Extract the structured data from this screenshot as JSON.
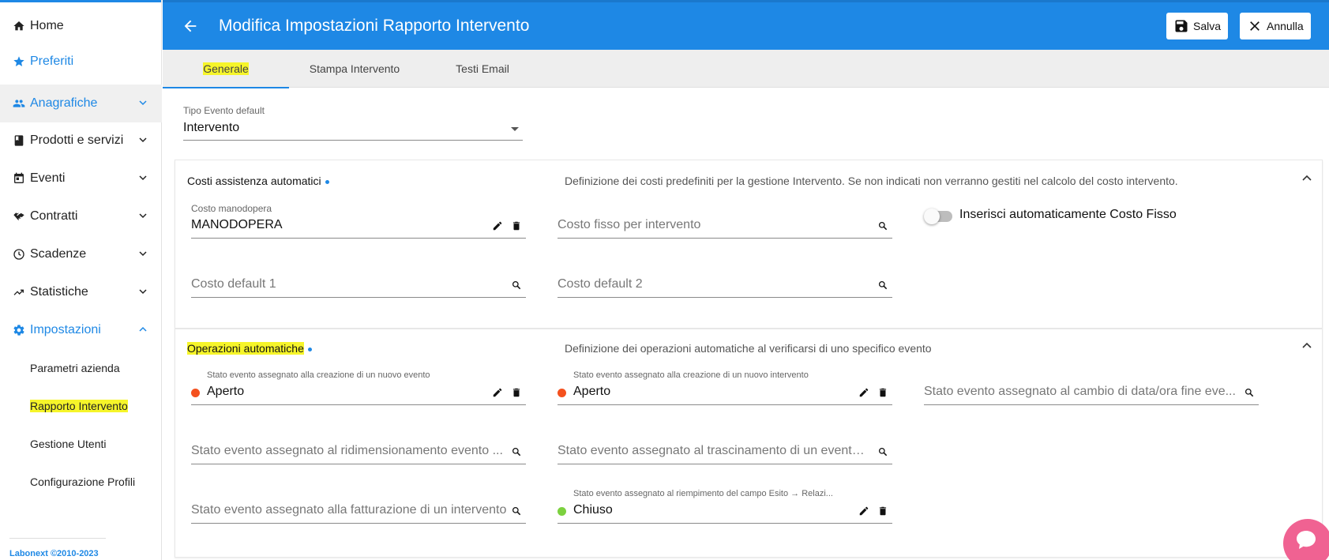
{
  "sidebar": {
    "items": [
      {
        "label": "Home",
        "icon": "home-icon"
      },
      {
        "label": "Preferiti",
        "icon": "star-icon"
      },
      {
        "label": "Anagrafiche",
        "icon": "people-icon"
      },
      {
        "label": "Prodotti e servizi",
        "icon": "book-icon"
      },
      {
        "label": "Eventi",
        "icon": "calendar-icon"
      },
      {
        "label": "Contratti",
        "icon": "handshake-icon"
      },
      {
        "label": "Scadenze",
        "icon": "clock-icon"
      },
      {
        "label": "Statistiche",
        "icon": "trending-up-icon"
      },
      {
        "label": "Impostazioni",
        "icon": "gear-icon"
      }
    ],
    "sub_items": [
      {
        "label": "Parametri azienda"
      },
      {
        "label": "Rapporto Intervento"
      },
      {
        "label": "Gestione Utenti"
      },
      {
        "label": "Configurazione Profili"
      }
    ],
    "footer": "Labonext ©2010-2023"
  },
  "header": {
    "title": "Modifica Impostazioni Rapporto Intervento",
    "save_label": "Salva",
    "cancel_label": "Annulla"
  },
  "tabs": [
    {
      "label": "Generale"
    },
    {
      "label": "Stampa Intervento"
    },
    {
      "label": "Testi Email"
    }
  ],
  "tipo_evento": {
    "label": "Tipo Evento default",
    "value": "Intervento"
  },
  "costi": {
    "title": "Costi assistenza automatici",
    "description": "Definizione dei costi predefiniti per la gestione Intervento. Se non indicati non verranno gestiti nel calcolo del costo intervento.",
    "manodopera_label": "Costo manodopera",
    "manodopera_value": "MANODOPERA",
    "costo_fisso_placeholder": "Costo fisso per intervento",
    "toggle_label": "Inserisci automaticamente Costo Fisso",
    "default1_placeholder": "Costo default 1",
    "default2_placeholder": "Costo default 2"
  },
  "operazioni": {
    "title": "Operazioni automatiche",
    "description": "Definizione dei operazioni automatiche al verificarsi di uno specifico evento",
    "f1_label": "Stato evento assegnato alla creazione di un nuovo evento",
    "f1_value": "Aperto",
    "f2_label": "Stato evento assegnato alla creazione di un nuovo intervento",
    "f2_value": "Aperto",
    "f3_placeholder": "Stato evento assegnato al cambio di data/ora fine eve...",
    "f4_placeholder": "Stato evento assegnato al ridimensionamento evento ...",
    "f5_placeholder": "Stato evento assegnato al trascinamento di un evento ...",
    "f6_placeholder": "Stato evento assegnato alla fatturazione di un intervento",
    "f7_label": "Stato evento assegnato al riempimento del campo Esito → Relazi...",
    "f7_value": "Chiuso"
  },
  "colors": {
    "primary": "#1e88e5",
    "aperto": "#f4511e",
    "chiuso": "#7cd13f",
    "highlight": "#f6f52a",
    "chat": "#f06292"
  }
}
